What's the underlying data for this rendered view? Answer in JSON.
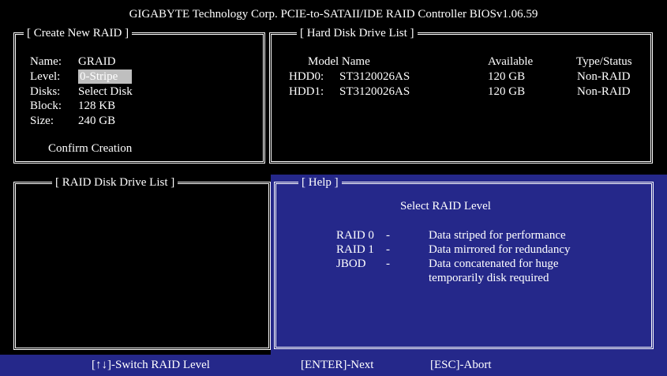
{
  "header": {
    "title": "GIGABYTE Technology Corp. PCIE-to-SATAII/IDE RAID Controller BIOSv1.06.59"
  },
  "create_raid": {
    "title": "[ Create New RAID ]",
    "fields": [
      {
        "label": "Name:",
        "value": "GRAID"
      },
      {
        "label": "Level:",
        "value": "0-Stripe"
      },
      {
        "label": "Disks:",
        "value": "Select Disk"
      },
      {
        "label": "Block:",
        "value": "128 KB"
      },
      {
        "label": "Size:",
        "value": "240 GB"
      }
    ],
    "confirm_label": "Confirm Creation"
  },
  "hdd_list": {
    "title": "[ Hard Disk Drive List ]",
    "columns": {
      "model": "Model Name",
      "available": "Available",
      "type": "Type/Status"
    },
    "rows": [
      {
        "id": "HDD0:",
        "model": "ST3120026AS",
        "available": "120 GB",
        "type": "Non-RAID"
      },
      {
        "id": "HDD1:",
        "model": "ST3120026AS",
        "available": "120 GB",
        "type": "Non-RAID"
      }
    ]
  },
  "raid_list": {
    "title": "[ RAID Disk Drive List ]"
  },
  "help": {
    "title": "[ Help ]",
    "heading": "Select RAID Level",
    "items": [
      {
        "key": "RAID 0",
        "dash": "-",
        "desc": "Data striped for performance"
      },
      {
        "key": "RAID 1",
        "dash": "-",
        "desc": "Data mirrored for redundancy"
      },
      {
        "key": "JBOD",
        "dash": "-",
        "desc": "Data concatenated for huge"
      }
    ],
    "desc_continuation": "temporarily disk required"
  },
  "footer": {
    "switch": "[↑↓]-Switch RAID Level",
    "next": "[ENTER]-Next",
    "abort": "[ESC]-Abort"
  },
  "colors": {
    "background": "#000000",
    "panel_blue": "#25288a",
    "selection": "#bfbfbf",
    "text": "#ffffff"
  }
}
